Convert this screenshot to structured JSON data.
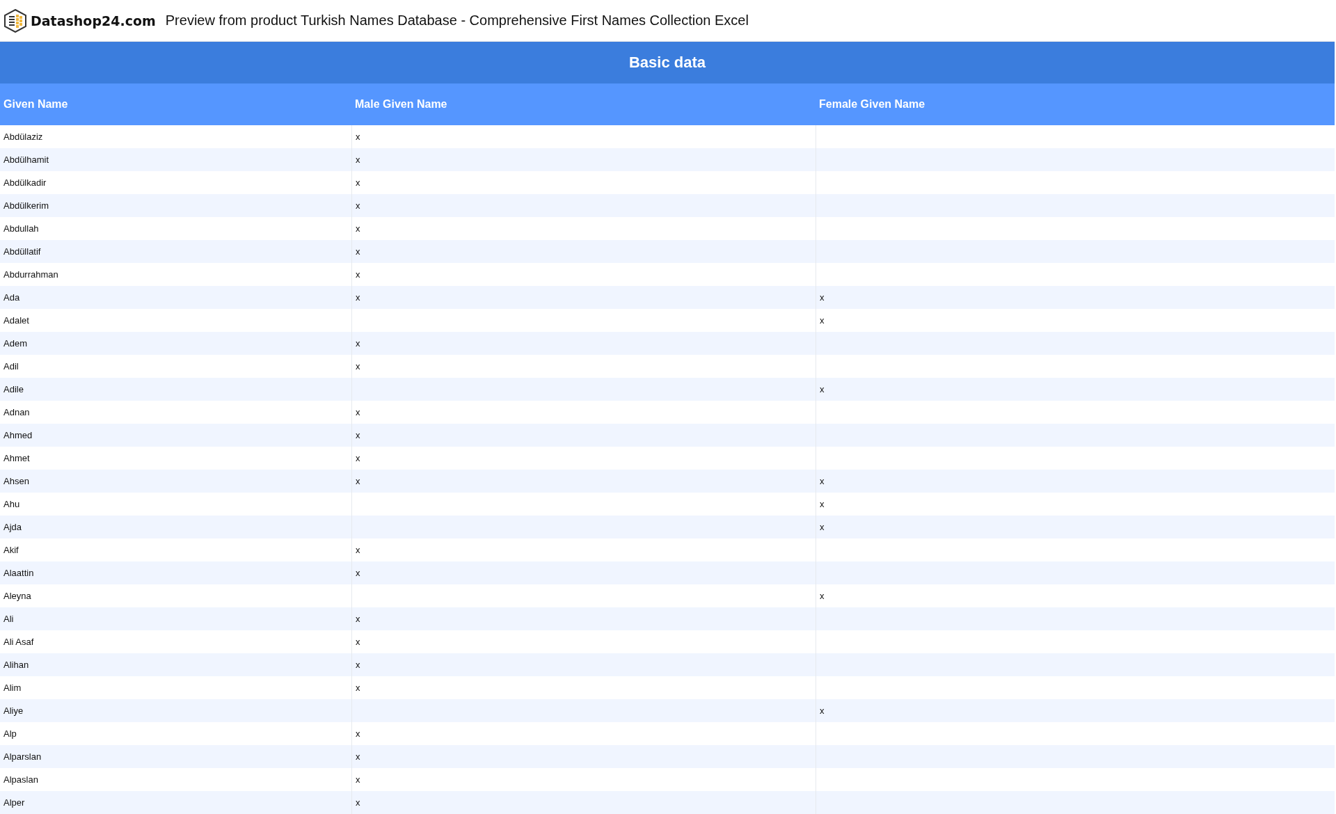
{
  "site": {
    "logo_text": "Datashop24.com",
    "title": "Preview from product Turkish Names Database - Comprehensive First Names Collection Excel"
  },
  "table": {
    "caption": "Basic data",
    "columns": [
      "Given Name",
      "Male Given Name",
      "Female Given Name"
    ],
    "rows": [
      {
        "name": "Abdülaziz",
        "male": "x"
      },
      {
        "name": "Abdülhamit",
        "male": "x"
      },
      {
        "name": "Abdülkadir",
        "male": "x"
      },
      {
        "name": "Abdülkerim",
        "male": "x"
      },
      {
        "name": "Abdullah",
        "male": "x"
      },
      {
        "name": "Abdüllatif",
        "male": "x"
      },
      {
        "name": "Abdurrahman",
        "male": "x"
      },
      {
        "name": "Ada",
        "male": "x",
        "female": "x"
      },
      {
        "name": "Adalet",
        "female": "x"
      },
      {
        "name": "Adem",
        "male": "x"
      },
      {
        "name": "Adil",
        "male": "x"
      },
      {
        "name": "Adile",
        "female": "x"
      },
      {
        "name": "Adnan",
        "male": "x"
      },
      {
        "name": "Ahmed",
        "male": "x"
      },
      {
        "name": "Ahmet",
        "male": "x"
      },
      {
        "name": "Ahsen",
        "male": "x",
        "female": "x"
      },
      {
        "name": "Ahu",
        "female": "x"
      },
      {
        "name": "Ajda",
        "female": "x"
      },
      {
        "name": "Akif",
        "male": "x"
      },
      {
        "name": "Alaattin",
        "male": "x"
      },
      {
        "name": "Aleyna",
        "female": "x"
      },
      {
        "name": "Ali",
        "male": "x"
      },
      {
        "name": "Ali Asaf",
        "male": "x"
      },
      {
        "name": "Alihan",
        "male": "x"
      },
      {
        "name": "Alim",
        "male": "x"
      },
      {
        "name": "Aliye",
        "female": "x"
      },
      {
        "name": "Alp",
        "male": "x"
      },
      {
        "name": "Alparslan",
        "male": "x"
      },
      {
        "name": "Alpaslan",
        "male": "x"
      },
      {
        "name": "Alper",
        "male": "x"
      }
    ]
  }
}
